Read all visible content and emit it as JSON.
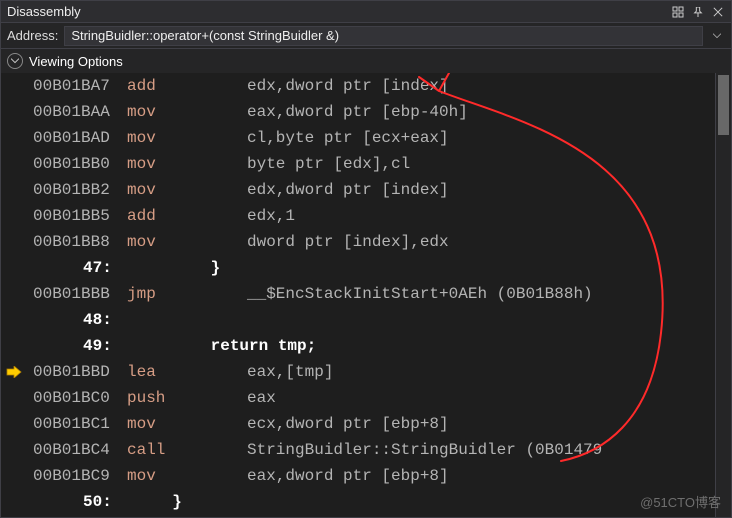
{
  "titlebar": {
    "title": "Disassembly"
  },
  "addressbar": {
    "label": "Address:",
    "value": "StringBuidler::operator+(const StringBuidler &)"
  },
  "options": {
    "label": "Viewing Options"
  },
  "watermark": "@51CTO博客",
  "lines": [
    {
      "t": "asm",
      "addr": "00B01BA7",
      "mnem": "add",
      "ops": "edx,dword ptr [index]"
    },
    {
      "t": "asm",
      "addr": "00B01BAA",
      "mnem": "mov",
      "ops": "eax,dword ptr [ebp-40h]"
    },
    {
      "t": "asm",
      "addr": "00B01BAD",
      "mnem": "mov",
      "ops": "cl,byte ptr [ecx+eax]"
    },
    {
      "t": "asm",
      "addr": "00B01BB0",
      "mnem": "mov",
      "ops": "byte ptr [edx],cl"
    },
    {
      "t": "asm",
      "addr": "00B01BB2",
      "mnem": "mov",
      "ops": "edx,dword ptr [index]"
    },
    {
      "t": "asm",
      "addr": "00B01BB5",
      "mnem": "add",
      "ops": "edx,1"
    },
    {
      "t": "asm",
      "addr": "00B01BB8",
      "mnem": "mov",
      "ops": "dword ptr [index],edx"
    },
    {
      "t": "src",
      "num": "47:",
      "code": "      }"
    },
    {
      "t": "asm",
      "addr": "00B01BBB",
      "mnem": "jmp",
      "ops": "__$EncStackInitStart+0AEh (0B01B88h)"
    },
    {
      "t": "src",
      "num": "48:",
      "code": ""
    },
    {
      "t": "src",
      "num": "49:",
      "code": "      return tmp;"
    },
    {
      "t": "asm",
      "ip": true,
      "addr": "00B01BBD",
      "mnem": "lea",
      "ops": "eax,[tmp]"
    },
    {
      "t": "asm",
      "addr": "00B01BC0",
      "mnem": "push",
      "ops": "eax"
    },
    {
      "t": "asm",
      "addr": "00B01BC1",
      "mnem": "mov",
      "ops": "ecx,dword ptr [ebp+8]"
    },
    {
      "t": "asm",
      "addr": "00B01BC4",
      "mnem": "call",
      "ops": "StringBuidler::StringBuidler (0B01479"
    },
    {
      "t": "asm",
      "addr": "00B01BC9",
      "mnem": "mov",
      "ops": "eax,dword ptr [ebp+8]"
    },
    {
      "t": "src",
      "num": "50:",
      "code": "  }"
    }
  ]
}
